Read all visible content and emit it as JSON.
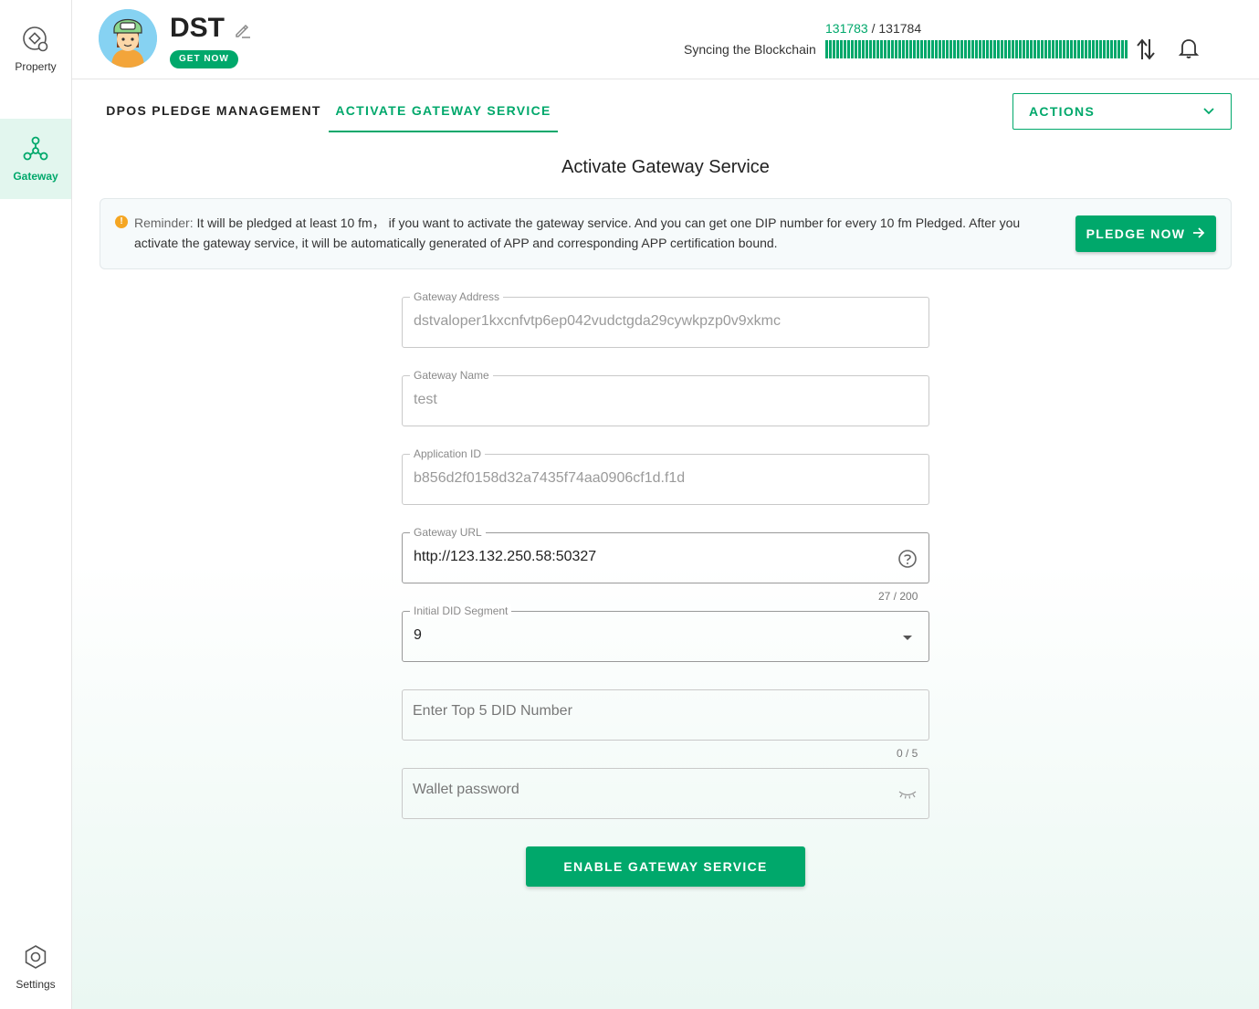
{
  "sidebar": {
    "items": [
      {
        "label": "Property",
        "icon": "property-icon"
      },
      {
        "label": "Gateway",
        "icon": "gateway-icon"
      },
      {
        "label": "Settings",
        "icon": "settings-icon"
      }
    ]
  },
  "header": {
    "name": "DST",
    "get_now": "GET NOW",
    "sync": {
      "current": "131783",
      "separator": " / ",
      "total": "131784",
      "label": "Syncing the Blockchain",
      "progress": 0.99999
    }
  },
  "tabs": [
    {
      "label": "DPOS PLEDGE MANAGEMENT"
    },
    {
      "label": "ACTIVATE GATEWAY SERVICE"
    }
  ],
  "actions": {
    "label": "ACTIONS"
  },
  "page_title": "Activate Gateway Service",
  "reminder": {
    "prefix": "Reminder:",
    "text": " It will be pledged at least 10 fm，  if you want to activate the gateway service. And you can get one DIP number for every 10 fm Pledged. After you activate the gateway service, it will be automatically generated of APP and corresponding APP certification bound.",
    "button": "PLEDGE NOW"
  },
  "form": {
    "gateway_address": {
      "label": "Gateway Address",
      "value": "dstvaloper1kxcnfvtp6ep042vudctgda29cywkpzp0v9xkmc"
    },
    "gateway_name": {
      "label": "Gateway Name",
      "value": "test"
    },
    "application_id": {
      "label": "Application ID",
      "value": "b856d2f0158d32a7435f74aa0906cf1d.f1d"
    },
    "gateway_url": {
      "label": "Gateway URL",
      "value": "http://123.132.250.58:50327",
      "counter": "27 / 200"
    },
    "initial_did_segment": {
      "label": "Initial DID Segment",
      "value": "9"
    },
    "top5_did": {
      "placeholder": "Enter Top 5 DID Number",
      "counter": "0 / 5"
    },
    "wallet_password": {
      "placeholder": "Wallet password"
    },
    "submit": "ENABLE GATEWAY SERVICE"
  },
  "colors": {
    "accent": "#00a86b",
    "active_nav_bg": "#e2f6ee",
    "warning": "#f5a623"
  }
}
